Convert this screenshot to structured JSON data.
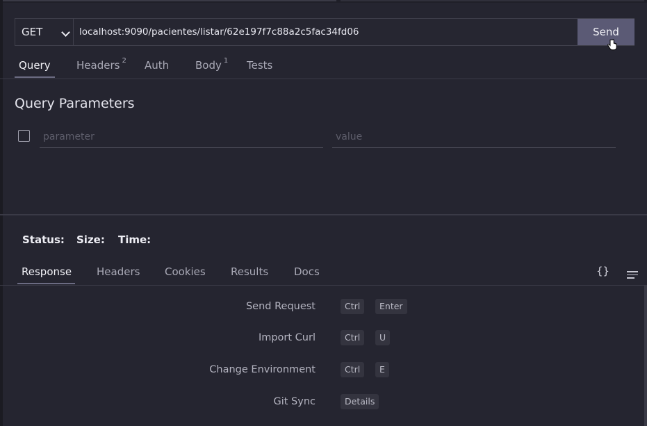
{
  "request": {
    "method": "GET",
    "url": "localhost:9090/pacientes/listar/62e197f7c88a2c5fac34fd06",
    "send_label": "Send"
  },
  "request_tabs": [
    {
      "label": "Query",
      "badge": ""
    },
    {
      "label": "Headers",
      "badge": "2"
    },
    {
      "label": "Auth",
      "badge": ""
    },
    {
      "label": "Body",
      "badge": "1"
    },
    {
      "label": "Tests",
      "badge": ""
    }
  ],
  "query": {
    "title": "Query Parameters",
    "param_placeholder": "parameter",
    "value_placeholder": "value"
  },
  "status": {
    "status_label": "Status:",
    "size_label": "Size:",
    "time_label": "Time:"
  },
  "response_tabs": [
    "Response",
    "Headers",
    "Cookies",
    "Results",
    "Docs"
  ],
  "shortcuts": [
    {
      "label": "Send Request",
      "keys": [
        "Ctrl",
        "Enter"
      ]
    },
    {
      "label": "Import Curl",
      "keys": [
        "Ctrl",
        "U"
      ]
    },
    {
      "label": "Change Environment",
      "keys": [
        "Ctrl",
        "E"
      ]
    },
    {
      "label": "Git Sync",
      "keys": [
        "Details"
      ]
    }
  ],
  "icons": {
    "format": "braces-icon",
    "menu": "lines-menu-icon"
  }
}
